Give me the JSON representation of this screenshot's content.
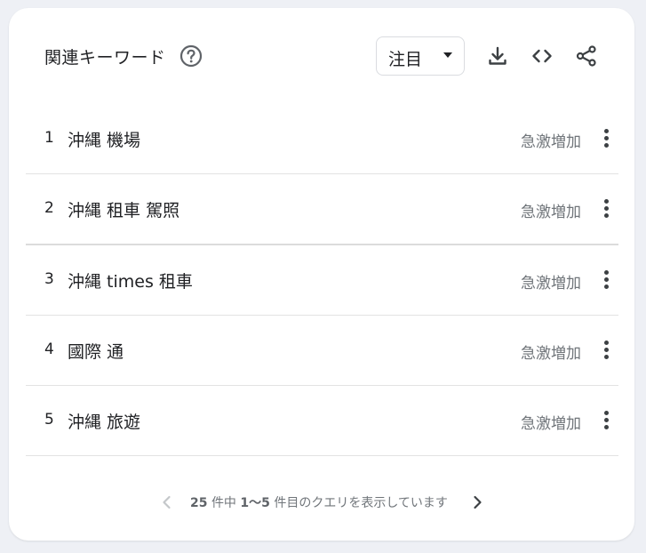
{
  "header": {
    "title": "関連キーワード",
    "help_icon": "help-circle-icon",
    "select_value": "注目",
    "tools": [
      "download-icon",
      "embed-code-icon",
      "share-icon"
    ]
  },
  "rows": [
    {
      "rank": "1",
      "term": "沖縄 機場",
      "trend": "急激増加"
    },
    {
      "rank": "2",
      "term": "沖縄 租車 駕照",
      "trend": "急激増加"
    },
    {
      "rank": "3",
      "term": "沖縄 times 租車",
      "trend": "急激増加"
    },
    {
      "rank": "4",
      "term": "國際 通",
      "trend": "急激増加"
    },
    {
      "rank": "5",
      "term": "沖縄 旅遊",
      "trend": "急激増加"
    }
  ],
  "pagination": {
    "total": "25",
    "range": "1〜5",
    "text_a": "件中",
    "text_b": "件目のクエリを表示しています"
  },
  "colors": {
    "text": "#202124",
    "muted": "#70757a",
    "divider": "#e3e3e3",
    "background": "#eef0f5"
  }
}
